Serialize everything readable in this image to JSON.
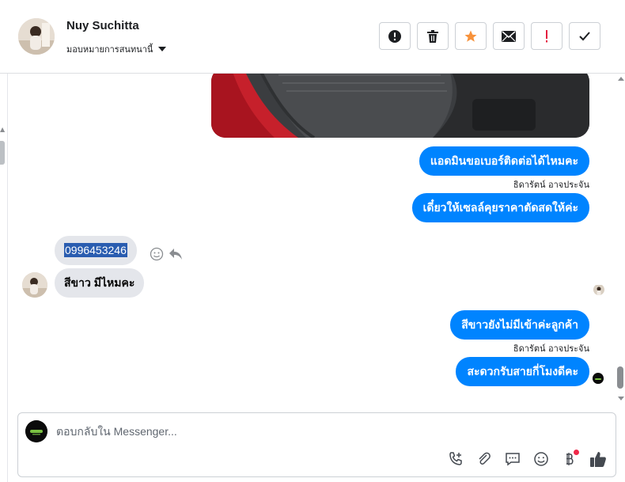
{
  "header": {
    "contact_name": "Nuy Suchitta",
    "assign_label": "มอบหมายการสนทนานี้",
    "actions": [
      {
        "name": "report-spam-button",
        "icon": "alert-circle-icon"
      },
      {
        "name": "delete-button",
        "icon": "trash-icon"
      },
      {
        "name": "star-button",
        "icon": "star-icon"
      },
      {
        "name": "mark-unread-button",
        "icon": "envelope-icon"
      },
      {
        "name": "follow-up-button",
        "icon": "exclamation-icon"
      },
      {
        "name": "mark-done-button",
        "icon": "check-icon"
      }
    ]
  },
  "messages": [
    {
      "type": "image",
      "from": "page",
      "description_icon": "car-seat-photo"
    },
    {
      "type": "text",
      "from": "page",
      "text": "แอดมินขอเบอร์ติดต่อได้ไหมคะ",
      "sender": "ธิดารัตน์ อาจประจัน"
    },
    {
      "type": "text",
      "from": "page",
      "text": "เดี๋ยวให้เซลล์คุยราคาตัดสดให้ค่ะ"
    },
    {
      "type": "text",
      "from": "customer",
      "text": "0996453246",
      "highlighted": true
    },
    {
      "type": "text",
      "from": "customer",
      "text": "สีขาว มีไหมคะ"
    },
    {
      "type": "text",
      "from": "page",
      "text": "สีขาวยังไม่มีเข้าค่ะลูกค้า",
      "sender": "ธิดารัตน์ อาจประจัน"
    },
    {
      "type": "text",
      "from": "page",
      "text": "สะดวกรับสายกี่โมงดีคะ"
    }
  ],
  "reply": {
    "placeholder": "ตอบกลับใน Messenger...",
    "tools": [
      "add-call-icon",
      "paperclip-icon",
      "saved-reply-icon",
      "emoji-icon",
      "baht-icon",
      "thumbs-up-icon"
    ]
  },
  "colors": {
    "outgoing_bubble": "#0084ff",
    "incoming_bubble": "#e4e6eb",
    "star": "#f7923b",
    "exclamation": "#e41e3f",
    "notification_dot": "#f02849"
  }
}
